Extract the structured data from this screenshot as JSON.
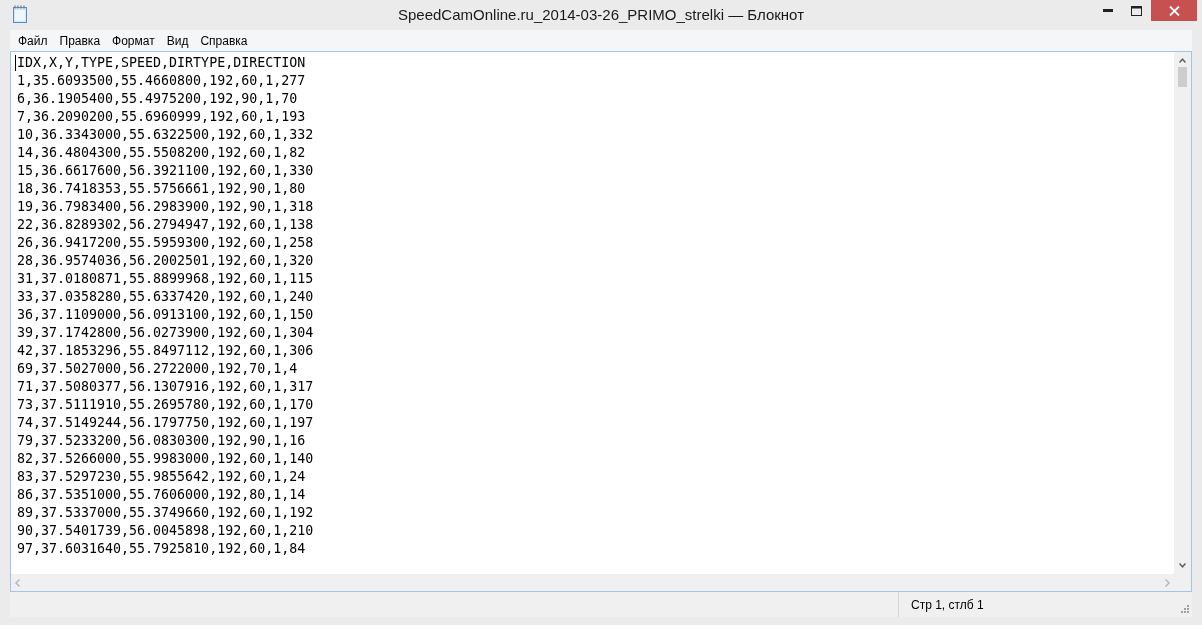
{
  "window": {
    "title": "SpeedCamOnline.ru_2014-03-26_PRIMO_strelki — Блокнот"
  },
  "menu": [
    {
      "label": "Файл"
    },
    {
      "label": "Правка"
    },
    {
      "label": "Формат"
    },
    {
      "label": "Вид"
    },
    {
      "label": "Справка"
    }
  ],
  "editor": {
    "lines": [
      "IDX,X,Y,TYPE,SPEED,DIRTYPE,DIRECTION",
      "1,35.6093500,55.4660800,192,60,1,277",
      "6,36.1905400,55.4975200,192,90,1,70",
      "7,36.2090200,55.6960999,192,60,1,193",
      "10,36.3343000,55.6322500,192,60,1,332",
      "14,36.4804300,55.5508200,192,60,1,82",
      "15,36.6617600,56.3921100,192,60,1,330",
      "18,36.7418353,55.5756661,192,90,1,80",
      "19,36.7983400,56.2983900,192,90,1,318",
      "22,36.8289302,56.2794947,192,60,1,138",
      "26,36.9417200,55.5959300,192,60,1,258",
      "28,36.9574036,56.2002501,192,60,1,320",
      "31,37.0180871,55.8899968,192,60,1,115",
      "33,37.0358280,55.6337420,192,60,1,240",
      "36,37.1109000,56.0913100,192,60,1,150",
      "39,37.1742800,56.0273900,192,60,1,304",
      "42,37.1853296,55.8497112,192,60,1,306",
      "69,37.5027000,56.2722000,192,70,1,4",
      "71,37.5080377,56.1307916,192,60,1,317",
      "73,37.5111910,55.2695780,192,60,1,170",
      "74,37.5149244,56.1797750,192,60,1,197",
      "79,37.5233200,56.0830300,192,90,1,16",
      "82,37.5266000,55.9983000,192,60,1,140",
      "83,37.5297230,55.9855642,192,60,1,24",
      "86,37.5351000,55.7606000,192,80,1,14",
      "89,37.5337000,55.3749660,192,60,1,192",
      "90,37.5401739,56.0045898,192,60,1,210",
      "97,37.6031640,55.7925810,192,60,1,84"
    ]
  },
  "status_bar": {
    "position": "Стр 1, стлб 1"
  }
}
